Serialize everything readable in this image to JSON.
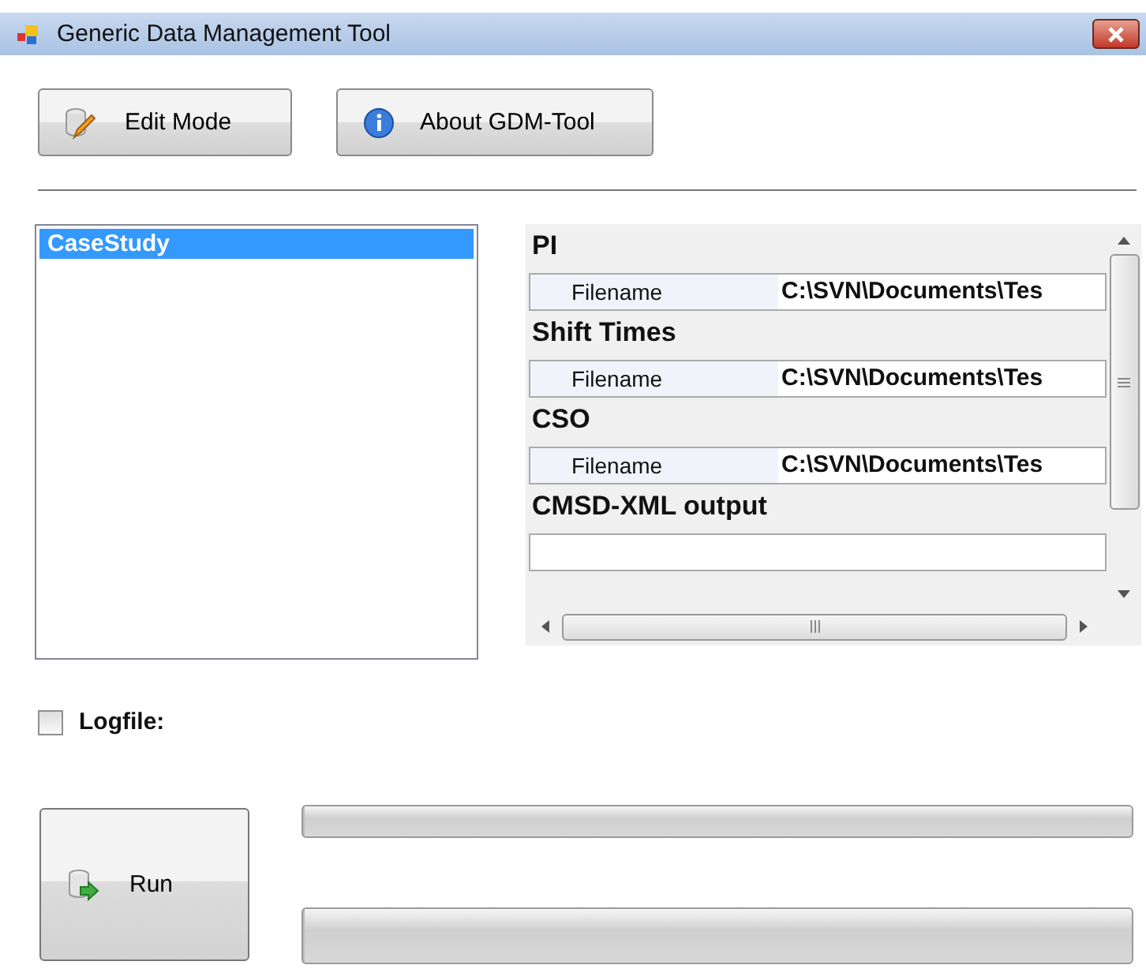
{
  "window": {
    "title": "Generic Data Management Tool"
  },
  "toolbar": [
    {
      "kind": "edit",
      "label": "Edit Mode"
    },
    {
      "kind": "info",
      "label": "About GDM-Tool"
    }
  ],
  "list": {
    "items": [
      {
        "label": "CaseStudy",
        "selected": true
      }
    ]
  },
  "properties": [
    {
      "category": "PI",
      "name": "Filename",
      "value": "C:\\SVN\\Documents\\Tes"
    },
    {
      "category": "Shift Times",
      "name": "Filename",
      "value": "C:\\SVN\\Documents\\Tes"
    },
    {
      "category": "CSO",
      "name": "Filename",
      "value": "C:\\SVN\\Documents\\Tes"
    },
    {
      "category": "CMSD-XML output"
    }
  ],
  "logfile": {
    "label": "Logfile:",
    "checked": false
  },
  "run_button": {
    "label": "Run"
  },
  "progress": [
    {
      "level": 0
    },
    {
      "level": 0
    }
  ]
}
